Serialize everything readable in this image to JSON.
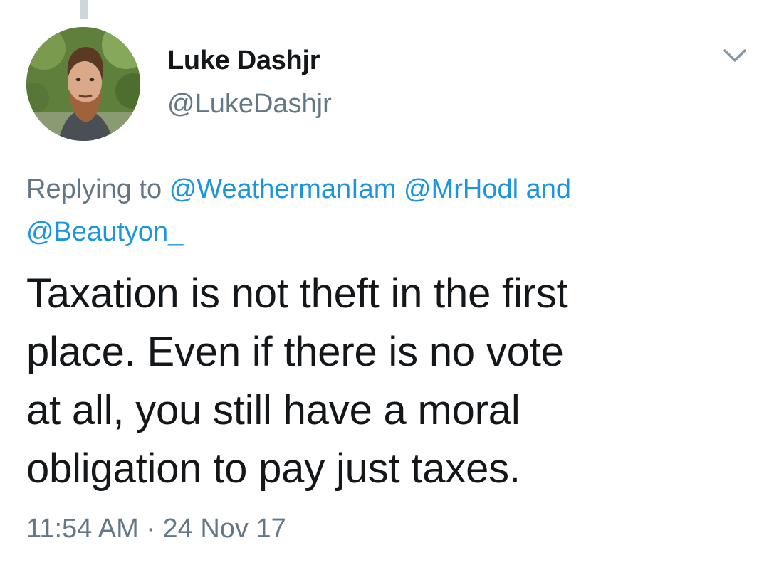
{
  "tweet": {
    "author": {
      "display_name": "Luke Dashjr",
      "handle": "@LukeDashjr",
      "avatar_icon": "profile-photo"
    },
    "replying_to": {
      "prefix": "Replying to",
      "mentions": [
        "@WeathermanIam",
        "@MrHodl",
        "@Beautyon_"
      ],
      "conjunction": "and"
    },
    "text_lines": [
      "Taxation is not theft in the first",
      "place. Even if there is no vote",
      "at all, you still have a moral",
      "obligation to pay just taxes."
    ],
    "time": "11:54 AM",
    "separator": "·",
    "date": "24 Nov 17",
    "menu_icon": "chevron-down-icon"
  },
  "colors": {
    "text": "#14171a",
    "secondary": "#657786",
    "link": "#1b95e0",
    "thread_line": "#ccd6dd"
  }
}
